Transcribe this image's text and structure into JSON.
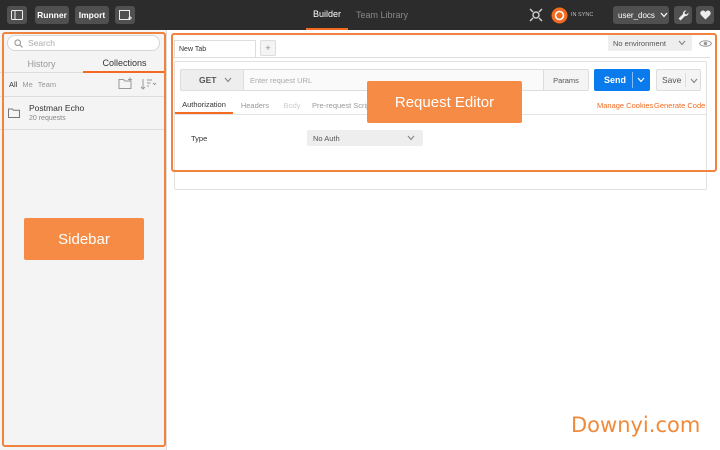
{
  "topbar": {
    "runner_label": "Runner",
    "import_label": "Import",
    "tabs": [
      {
        "label": "Builder",
        "active": true
      },
      {
        "label": "Team Library",
        "active": false
      }
    ],
    "sync_label": "IN SYNC",
    "user_label": "user_docs"
  },
  "sidebar": {
    "search_placeholder": "Search",
    "tabs": [
      {
        "label": "History",
        "active": false
      },
      {
        "label": "Collections",
        "active": true
      }
    ],
    "filters": [
      {
        "label": "All",
        "active": true
      },
      {
        "label": "Me",
        "active": false
      },
      {
        "label": "Team",
        "active": false
      }
    ],
    "collections": [
      {
        "name": "Postman Echo",
        "meta": "20 requests"
      }
    ]
  },
  "request": {
    "tab_label": "New Tab",
    "add_tab_label": "+",
    "environment": "No environment",
    "method": "GET",
    "url_placeholder": "Enter request URL",
    "params_label": "Params",
    "send_label": "Send",
    "save_label": "Save",
    "subtabs": [
      {
        "label": "Authorization",
        "active": true
      },
      {
        "label": "Headers",
        "active": false
      },
      {
        "label": "Body",
        "active": false
      },
      {
        "label": "Pre-request Script",
        "active": false
      }
    ],
    "manage_cookies": "Manage Cookies",
    "generate_code": "Generate Code",
    "type_label": "Type",
    "auth_value": "No Auth"
  },
  "annotations": {
    "sidebar_callout": "Sidebar",
    "editor_callout": "Request Editor",
    "watermark": "Downyi.com"
  },
  "colors": {
    "accent": "#f26b21",
    "send_blue": "#097bed",
    "callout": "#f58b45",
    "topbar": "#2c2c2c"
  }
}
